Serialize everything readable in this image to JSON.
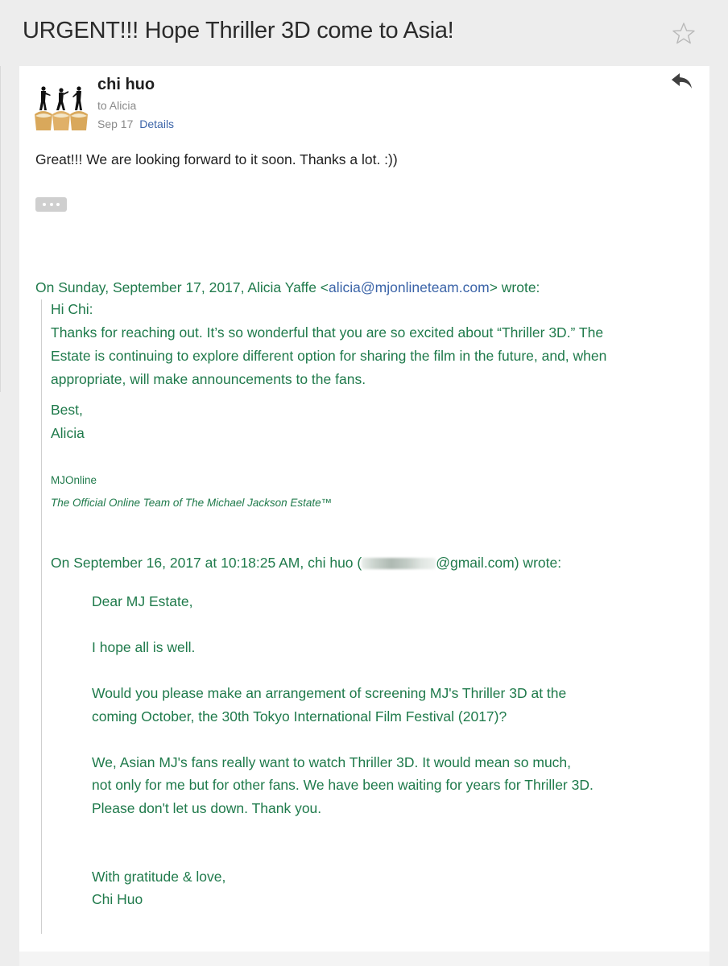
{
  "subject": "URGENT!!! Hope Thriller 3D come to Asia!",
  "icons": {
    "star": "star-outline-icon",
    "reply": "reply-icon",
    "more": "ellipsis-icon",
    "avatar": "avatar-silhouettes-on-cupcakes"
  },
  "colors": {
    "quote_text": "#1f7a4b",
    "link": "#3b64a8",
    "background": "#ededed"
  },
  "message": {
    "sender": "chi huo",
    "to": "to Alicia",
    "date": "Sep 17",
    "details_label": "Details",
    "body": "Great!!! We are looking forward to it soon. Thanks a lot. :))"
  },
  "quoted": {
    "header_prefix": "On Sunday, September 17, 2017, Alicia Yaffe <",
    "header_email": "alicia@mjonlineteam.com",
    "header_suffix": "> wrote:",
    "greeting": "Hi Chi:",
    "lines": [
      "Thanks for reaching out. It’s so wonderful that you are so excited about “Thriller 3D.” The",
      "Estate is continuing to explore different option for sharing the film in the future, and, when",
      "appropriate, will make announcements to the fans."
    ],
    "signoff": "Best,",
    "signer": "Alicia",
    "org": "MJOnline",
    "org_tagline": "The Official Online Team of The Michael Jackson Estate™"
  },
  "nested": {
    "header_prefix": "On September 16, 2017 at 10:18:25 AM, chi huo (",
    "header_suffix": "@gmail.com) wrote:",
    "salutation": "Dear MJ Estate,",
    "p1": "I hope  all is well.",
    "p2": [
      "Would you please make an arrangement of screening MJ's Thriller 3D at the",
      "coming October, the 30th Tokyo International Film Festival (2017)?"
    ],
    "p3": [
      "We, Asian MJ's fans really want to watch Thriller 3D. It would mean so much,",
      "not only for me but for other fans. We have been waiting for years for Thriller 3D.",
      "Please don't let us down. Thank you."
    ],
    "closing": "With gratitude & love,",
    "name": "Chi Huo"
  }
}
